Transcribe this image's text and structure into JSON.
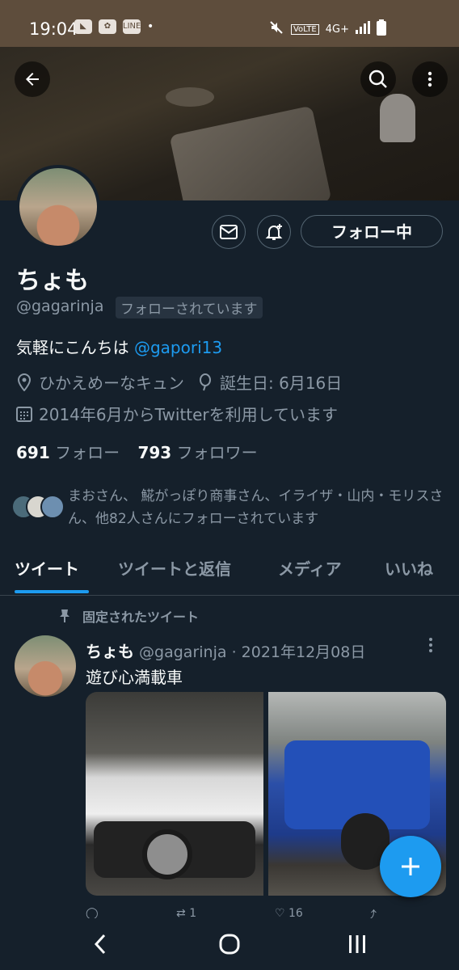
{
  "status_bar": {
    "time": "19:04",
    "left_icons": [
      "notification-icon",
      "line-icon",
      "dot-icon"
    ],
    "line_label": "LINE",
    "network": "4G+",
    "volte": "VoLTE"
  },
  "profile": {
    "name": "ちょも",
    "handle": "@gagarinja",
    "follows_you": "フォローされています",
    "bio_text": "気軽にこんちは ",
    "bio_mention": "@gapori13",
    "location": "ひかえめーなキュン",
    "birthday": "誕生日: 6月16日",
    "joined": "2014年6月からTwitterを利用しています",
    "following_count": "691",
    "following_label": "フォロー",
    "followers_count": "793",
    "followers_label": "フォロワー",
    "known_followers": "まおさん、 𩸽がっぽり商事さん、イライザ・山内・モリスさん、他82人さんにフォローされています"
  },
  "buttons": {
    "follow_state": "フォロー中"
  },
  "tabs": [
    {
      "label": "ツイート",
      "active": true
    },
    {
      "label": "ツイートと返信",
      "active": false
    },
    {
      "label": "メディア",
      "active": false
    },
    {
      "label": "いいね",
      "active": false
    }
  ],
  "pinned_tweet": {
    "pinned_label": "固定されたツイート",
    "author_name": "ちょも",
    "author_handle": "@gagarinja",
    "separator": "·",
    "date": "2021年12月08日",
    "text": "遊び心満載車",
    "retweets": "1",
    "likes": "16"
  },
  "colors": {
    "background": "#15202b",
    "accent": "#1d9bf0",
    "muted": "#8b98a5"
  }
}
